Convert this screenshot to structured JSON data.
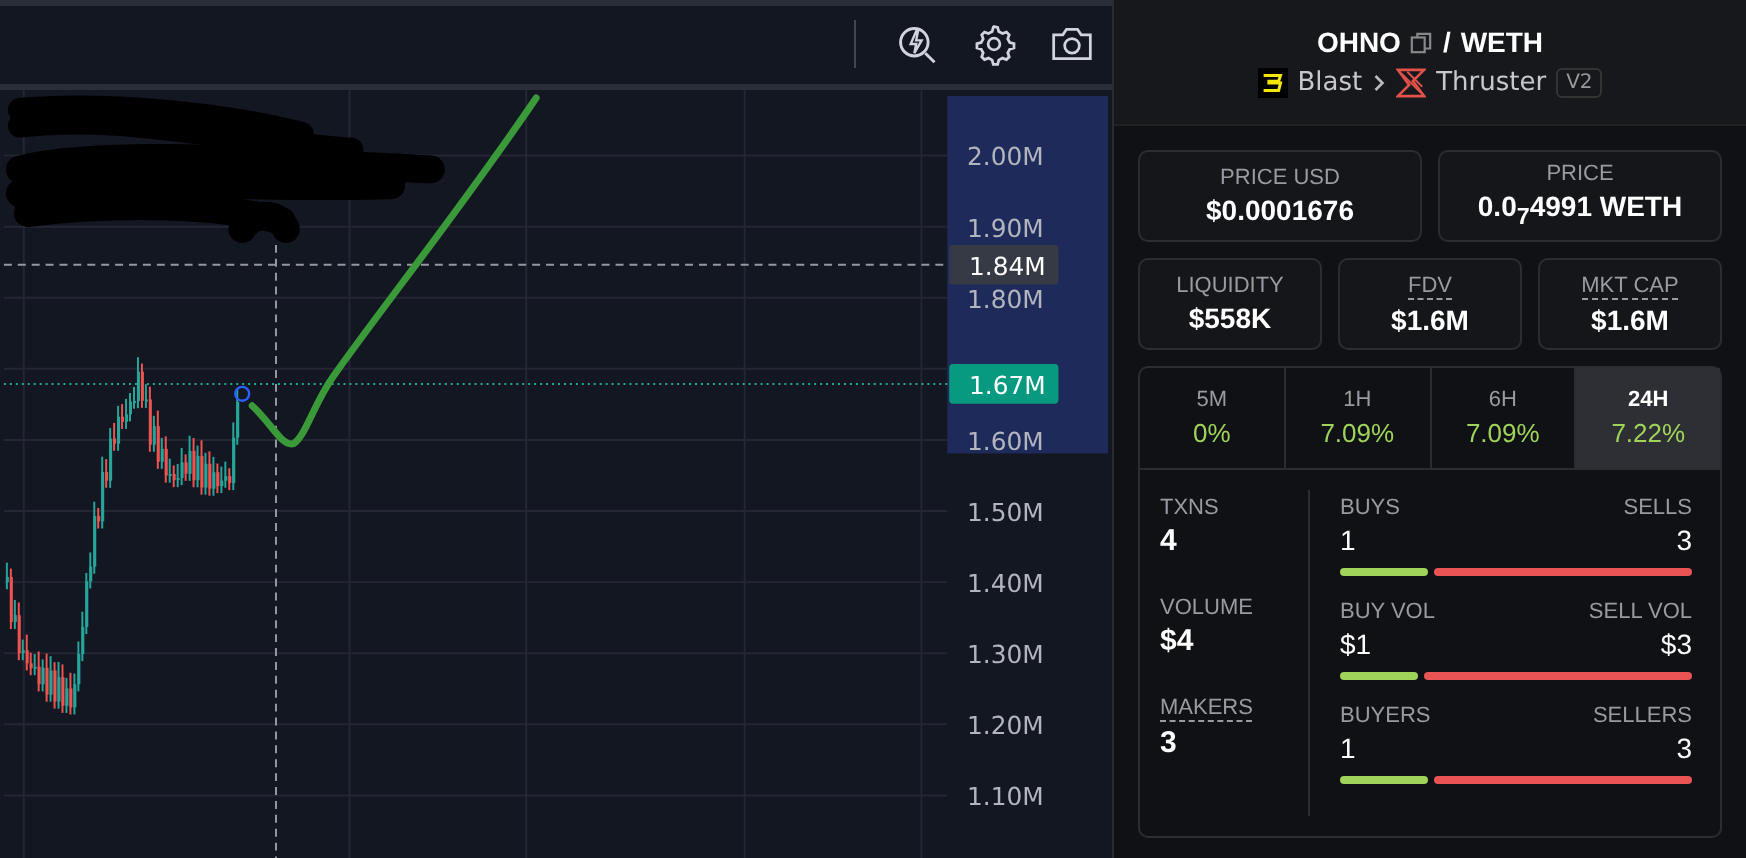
{
  "chart": {
    "price_axis": [
      "2.00M",
      "1.90M",
      "1.80M",
      "1.60M",
      "1.50M",
      "1.40M",
      "1.30M",
      "1.20M",
      "1.10M"
    ],
    "crosshair_label": "1.84M",
    "last_price_label": "1.67M"
  },
  "pair": {
    "base": "OHNO",
    "separator": "/",
    "quote": "WETH",
    "chain": "Blast",
    "dex": "Thruster",
    "version": "V2"
  },
  "prices": [
    {
      "label": "PRICE USD",
      "value": "$0.0001676"
    },
    {
      "label": "PRICE",
      "value": "0.0$_{7}$4991 WETH"
    }
  ],
  "metrics": [
    {
      "label": "LIQUIDITY",
      "value": "$558K",
      "dashed": false
    },
    {
      "label": "FDV",
      "value": "$1.6M",
      "dashed": true
    },
    {
      "label": "MKT CAP",
      "value": "$1.6M",
      "dashed": true
    }
  ],
  "timeframes": [
    {
      "label": "5M",
      "change": "0%",
      "selected": false
    },
    {
      "label": "1H",
      "change": "7.09%",
      "selected": false
    },
    {
      "label": "6H",
      "change": "7.09%",
      "selected": false
    },
    {
      "label": "24H",
      "change": "7.22%",
      "selected": true
    }
  ],
  "totals": [
    {
      "label": "TXNS",
      "value": "4",
      "dashed": false
    },
    {
      "label": "VOLUME",
      "value": "$4",
      "dashed": false
    },
    {
      "label": "MAKERS",
      "value": "3",
      "dashed": true
    }
  ],
  "splits": [
    {
      "left_label": "BUYS",
      "left_value": "1",
      "right_label": "SELLS",
      "right_value": "3",
      "level": 0.25
    },
    {
      "left_label": "BUY VOL",
      "left_value": "$1",
      "right_label": "SELL VOL",
      "right_value": "$3",
      "level": 0.22
    },
    {
      "left_label": "BUYERS",
      "left_value": "1",
      "right_label": "SELLERS",
      "right_value": "3",
      "level": 0.25
    }
  ]
}
